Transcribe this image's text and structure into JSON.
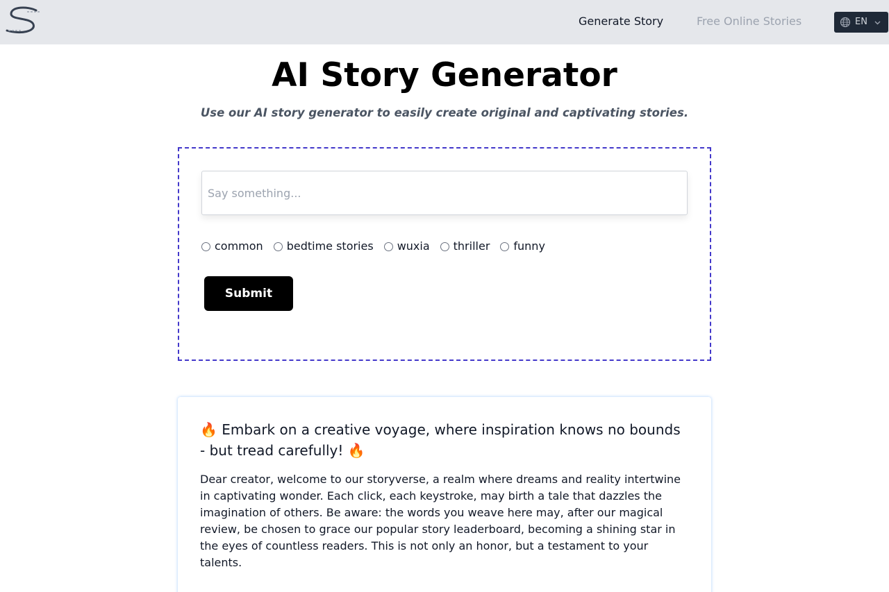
{
  "nav": {
    "generate_label": "Generate Story",
    "free_label": "Free Online Stories",
    "language": "EN"
  },
  "hero": {
    "title": "AI Story Generator",
    "subtitle": "Use our AI story generator to easily create original and captivating stories."
  },
  "form": {
    "prompt_placeholder": "Say something...",
    "prompt_value": "",
    "story_types": [
      "common",
      "bedtime stories",
      "wuxia",
      "thriller",
      "funny"
    ],
    "submit_label": "Submit"
  },
  "notice": {
    "heading": "🔥 Embark on a creative voyage, where inspiration knows no bounds - but tread carefully! 🔥",
    "body": "Dear creator, welcome to our storyverse, a realm where dreams and reality intertwine in captivating wonder. Each click, each keystroke, may birth a tale that dazzles the imagination of others. Be aware: the words you weave here may, after our magical review, be chosen to grace our popular story leaderboard, becoming a shining star in the eyes of countless readers. This is not only an honor, but a testament to your talents."
  },
  "colors": {
    "nav_background": "#e5e7eb",
    "form_border": "#4338ca",
    "submit_background": "#000000",
    "language_button": "#1f2937"
  },
  "icons": {
    "logo": "script-s-logo",
    "language": "globe-icon",
    "dropdown": "chevron-down-icon"
  }
}
